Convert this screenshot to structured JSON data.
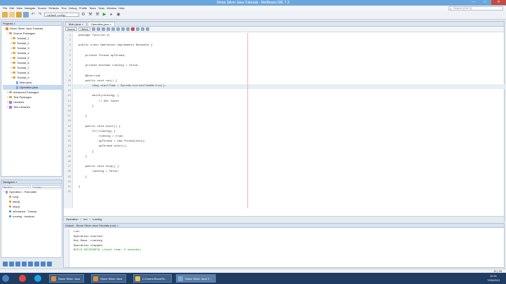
{
  "window": {
    "title": "Stone Silver Java Tutorials - NetBeans IDE 7.3",
    "minimize_label": "—",
    "maximize_label": "□",
    "close_label": "✕"
  },
  "menu": [
    "File",
    "Edit",
    "View",
    "Navigate",
    "Source",
    "Refactor",
    "Run",
    "Debug",
    "Profile",
    "Team",
    "Tools",
    "Window",
    "Help"
  ],
  "search": {
    "placeholder": "Search (Ctrl+I)"
  },
  "toolbar": {
    "config": "<default config>"
  },
  "projects": {
    "header": "Projects ×",
    "root": "Stone Silver Java Tutorials",
    "source_packages": "Source Packages",
    "packages": [
      "Tutorial_1",
      "Tutorial_2",
      "Tutorial_3",
      "Tutorial_4",
      "Tutorial_5",
      "Tutorial_6",
      "Tutorial_7",
      "Tutorial_8",
      "Tutorial_9"
    ],
    "files": [
      "Main.java",
      "Operation.java"
    ],
    "other_nodes": [
      "Advanced Packages",
      "Test Packages",
      "Libraries",
      "Test Libraries"
    ]
  },
  "navigator": {
    "header": "Navigator ×",
    "filter_left": "Members",
    "filter_right": "<empty>",
    "root": "Operation :: Runnable",
    "members": [
      "run()",
      "start()",
      "stop()",
      "isFinished : Thread",
      "running : boolean"
    ]
  },
  "editor": {
    "tabs": [
      "Main.java ×",
      "Operation.java ×"
    ],
    "toolbar_buttons": [
      "Source",
      "History"
    ],
    "lines": [
      {
        "n": "1",
        "text": "package Tutorial_9;"
      },
      {
        "n": "2",
        "text": ""
      },
      {
        "n": "3",
        "text": "public class Operation implements Runnable {"
      },
      {
        "n": "4",
        "text": ""
      },
      {
        "n": "5",
        "text": "    private Thread opThread;"
      },
      {
        "n": "6",
        "text": ""
      },
      {
        "n": "7",
        "text": "    private boolean running = false;"
      },
      {
        "n": "8",
        "text": ""
      },
      {
        "n": "9",
        "text": "    @Override"
      },
      {
        "n": "10",
        "text": "    public void run() {"
      },
      {
        "n": "11",
        "text": "        long startTime = System.currentTimeMillis();"
      },
      {
        "n": "12",
        "text": ""
      },
      {
        "n": "13",
        "text": "        while(running) {"
      },
      {
        "n": "14",
        "text": "            // Get Input"
      },
      {
        "n": "15",
        "text": "        }"
      },
      {
        "n": "16",
        "text": ""
      },
      {
        "n": "17",
        "text": "    }"
      },
      {
        "n": "18",
        "text": ""
      },
      {
        "n": "19",
        "text": "    public void start() {"
      },
      {
        "n": "20",
        "text": "        if(!running) {"
      },
      {
        "n": "21",
        "text": "            running = true;"
      },
      {
        "n": "22",
        "text": "            opThread = new Thread(this);"
      },
      {
        "n": "23",
        "text": "            opThread.start();"
      },
      {
        "n": "24",
        "text": "        }"
      },
      {
        "n": "25",
        "text": "    }"
      },
      {
        "n": "26",
        "text": ""
      },
      {
        "n": "27",
        "text": "    public void stop() {"
      },
      {
        "n": "28",
        "text": "        running = false;"
      },
      {
        "n": "29",
        "text": "    }"
      },
      {
        "n": "30",
        "text": ""
      },
      {
        "n": "31",
        "text": "}"
      },
      {
        "n": "32",
        "text": ""
      }
    ],
    "bottom_tabs": [
      "Operation",
      "run",
      "running"
    ]
  },
  "output": {
    "header": "Output - Stone Silver Java Tutorials (run) ×",
    "lines": [
      "run:",
      "Operation started.",
      "Key Down: running",
      "Operation stopped.",
      "BUILD SUCCESSFUL (total time: 5 seconds)"
    ]
  },
  "statusbar": {
    "position": "11 | 15"
  },
  "taskbar": {
    "tasks": [
      "Stone Silver Java",
      "Stone Silver Java",
      "C:\\Users\\StoneSil...",
      "Stone Silver Java T..."
    ],
    "time": "10:31",
    "date": "7/25/2013"
  },
  "colors": {
    "titlebar": "#6aa6dc",
    "taskbar": "#1f3c63",
    "keyword": "#0000b8",
    "field": "#0a8a0a"
  }
}
